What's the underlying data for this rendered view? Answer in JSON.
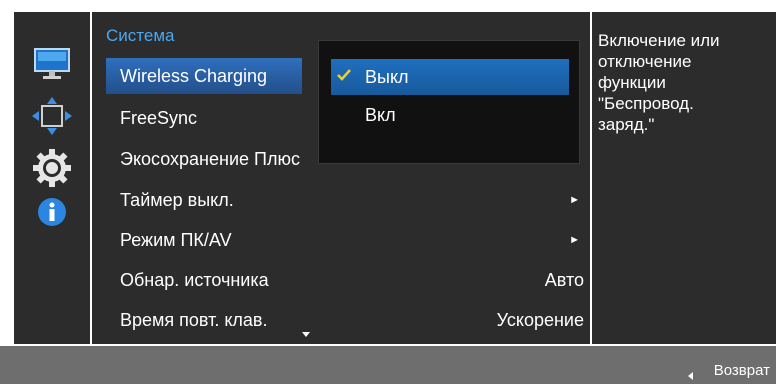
{
  "menu": {
    "section_title": "Система",
    "items": [
      {
        "label": "Wireless Charging",
        "value": "",
        "has_arrow": false,
        "selected": true
      },
      {
        "label": "FreeSync",
        "value": "",
        "has_arrow": false,
        "selected": false
      },
      {
        "label": "Экосохранение Плюс",
        "value": "",
        "has_arrow": false,
        "selected": false
      },
      {
        "label": "Таймер выкл.",
        "value": "",
        "arrow": "►",
        "selected": false
      },
      {
        "label": "Режим ПК/AV",
        "value": "",
        "arrow": "►",
        "selected": false
      },
      {
        "label": "Обнар. источника",
        "value": "Авто",
        "selected": false
      },
      {
        "label": "Время повт. клав.",
        "value": "Ускорение",
        "selected": false
      }
    ]
  },
  "submenu": {
    "options": [
      {
        "label": "Выкл",
        "checked": true
      },
      {
        "label": "Вкл",
        "checked": false
      }
    ]
  },
  "help": {
    "text": "Включение или\nотключение\nфункции\n\"Беспровод.\nзаряд.\""
  },
  "footer": {
    "return_label": "Возврат"
  },
  "icons": [
    "monitor-icon",
    "position-arrows-icon",
    "gear-icon",
    "info-icon"
  ],
  "colors": {
    "accent_blue": "#4aa8f0",
    "selection_blue": "#2f6fbd",
    "check_yellow": "#e8d233",
    "panel_bg": "#2c2c2c",
    "bottom_bar": "#6e6e6e"
  }
}
